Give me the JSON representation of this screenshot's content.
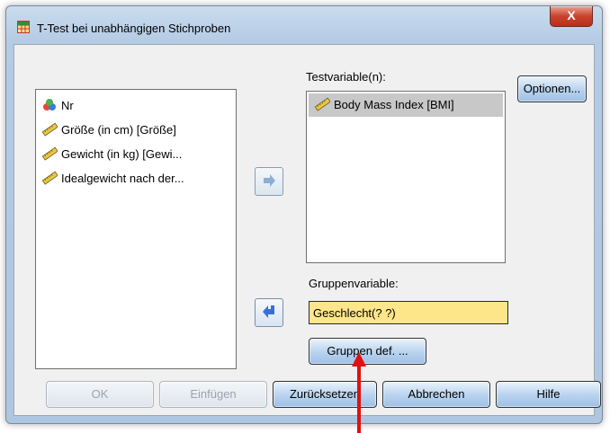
{
  "window": {
    "title": "T-Test bei unabhängigen Stichproben",
    "close_label": "X"
  },
  "source_list": {
    "items": [
      {
        "label": "Nr",
        "icon": "nominal-variable-icon"
      },
      {
        "label": "Größe (in cm) [Größe]",
        "icon": "scale-variable-icon"
      },
      {
        "label": "Gewicht (in kg) [Gewi...",
        "icon": "scale-variable-icon"
      },
      {
        "label": "Idealgewicht nach der...",
        "icon": "scale-variable-icon"
      }
    ]
  },
  "test_variables": {
    "label": "Testvariable(n):",
    "items": [
      {
        "label": "Body Mass Index [BMI]",
        "icon": "scale-variable-icon",
        "selected": true
      }
    ]
  },
  "grouping": {
    "label": "Gruppenvariable:",
    "value": "Geschlecht(? ?)"
  },
  "buttons": {
    "options": "Optionen...",
    "define_groups": "Gruppen def. ...",
    "ok": "OK",
    "paste": "Einfügen",
    "reset": "Zurücksetzen",
    "cancel": "Abbrechen",
    "help": "Hilfe"
  },
  "colors": {
    "arrow_blue": "#3a6fd8",
    "pointer_red": "#e01010",
    "field_yellow": "#fde68a"
  }
}
